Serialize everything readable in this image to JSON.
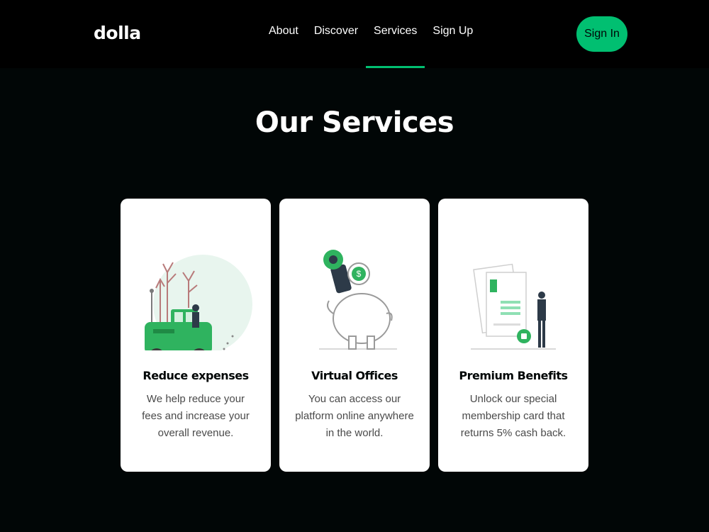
{
  "nav": {
    "logo": "dolla",
    "items": [
      {
        "label": "About"
      },
      {
        "label": "Discover"
      },
      {
        "label": "Services"
      },
      {
        "label": "Sign Up"
      }
    ],
    "active": "Services",
    "signin_label": "Sign In"
  },
  "services": {
    "title": "Our Services",
    "cards": [
      {
        "title": "Reduce expenses",
        "text": "We help reduce your fees and increase your overall revenue.",
        "illustration": "car-illustration"
      },
      {
        "title": "Virtual Offices",
        "text": "You can access our platform online anywhere in the world.",
        "illustration": "piggy-bank-illustration"
      },
      {
        "title": "Premium Benefits",
        "text": "Unlock our special membership card that returns 5% cash back.",
        "illustration": "document-lock-illustration"
      }
    ]
  },
  "colors": {
    "accent": "#01bf71",
    "background": "#010606",
    "nav": "#000000",
    "card": "#ffffff"
  }
}
